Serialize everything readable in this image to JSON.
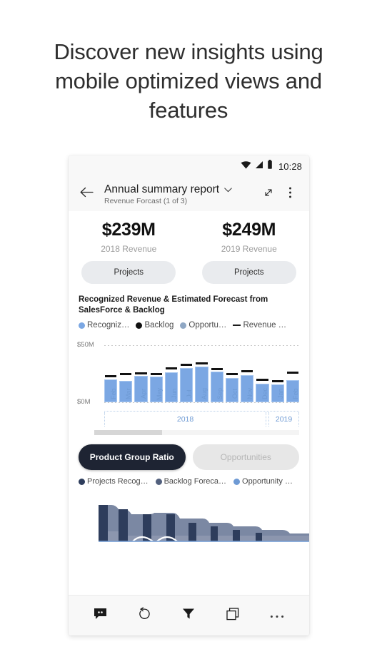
{
  "headline": "Discover new insights using mobile optimized views and features",
  "status_bar": {
    "time": "10:28",
    "icons": [
      "wifi-icon",
      "signal-icon",
      "battery-icon"
    ]
  },
  "app_bar": {
    "back_icon": "back-arrow-icon",
    "title": "Annual summary report",
    "subtitle": "Revenue Forcast  (1 of 3)",
    "dropdown_icon": "chevron-down-icon",
    "expand_icon": "expand-icon",
    "more_icon": "more-vertical-icon"
  },
  "kpis": [
    {
      "value": "$239M",
      "label": "2018 Revenue",
      "button": "Projects"
    },
    {
      "value": "$249M",
      "label": "2019 Revenue",
      "button": "Projects"
    }
  ],
  "bar_chart": {
    "title": "Recognized Revenue & Estimated Forecast from SalesForce & Backlog",
    "y_top_label": "$50M",
    "y_bottom_label": "$0M",
    "legend": [
      {
        "label": "Recogniz…",
        "color": "#7ba7e3",
        "marker": "dot"
      },
      {
        "label": "Backlog",
        "color": "#111111",
        "marker": "dot"
      },
      {
        "label": "Opportu…",
        "color": "#8fa7c4",
        "marker": "dot"
      },
      {
        "label": "Revenue …",
        "color": "#1b1b1b",
        "marker": "line"
      }
    ]
  },
  "chart_data": {
    "type": "bar",
    "title": "Recognized Revenue & Estimated Forecast from SalesForce & Backlog",
    "xlabel": "",
    "ylabel": "",
    "ylim": [
      0,
      50
    ],
    "grid": true,
    "legend_position": "top",
    "categories": [
      "Feb",
      "Mar",
      "Apr",
      "May",
      "Jun",
      "Jul",
      "Aug",
      "Sep",
      "Oct",
      "Nov",
      "Dec",
      "Jan",
      "Feb"
    ],
    "category_groups": [
      {
        "label": "2018",
        "count": 11
      },
      {
        "label": "2019",
        "count": 2
      }
    ],
    "series": [
      {
        "name": "Recognized Revenue",
        "type": "bar",
        "color": "#7ba7e3",
        "values": [
          20,
          18.5,
          23,
          22.5,
          26,
          30,
          31.5,
          27,
          21,
          24,
          16.5,
          15.5,
          19.5
        ]
      },
      {
        "name": "Revenue Forecast",
        "type": "marker-line",
        "color": "#111111",
        "values": [
          22,
          24,
          24.5,
          24,
          28.5,
          32,
          33,
          28,
          23.5,
          26.5,
          18.5,
          17.5,
          25
        ]
      }
    ]
  },
  "scrollbar": {
    "thumb_percent": 33
  },
  "tabs": [
    {
      "label": "Product Group Ratio",
      "active": true
    },
    {
      "label": "Opportunities",
      "active": false
    }
  ],
  "legend2": [
    {
      "label": "Projects Recog…",
      "color": "#2e3d5c"
    },
    {
      "label": "Backlog Foreca…",
      "color": "#52607d"
    },
    {
      "label": "Opportunity …",
      "color": "#6e9ad4"
    }
  ],
  "area_chart": {
    "type": "area",
    "description": "Stacked area with overlaid columns, descending left to right",
    "area_color": "#7b88a3",
    "column_color": "#2e3d5c"
  },
  "toolbar": [
    {
      "icon": "comment-icon",
      "name": "comments-button"
    },
    {
      "icon": "refresh-icon",
      "name": "refresh-button"
    },
    {
      "icon": "filter-icon",
      "name": "filter-button"
    },
    {
      "icon": "pages-icon",
      "name": "pages-button"
    },
    {
      "icon": "more-horizontal-icon",
      "name": "more-button"
    }
  ]
}
